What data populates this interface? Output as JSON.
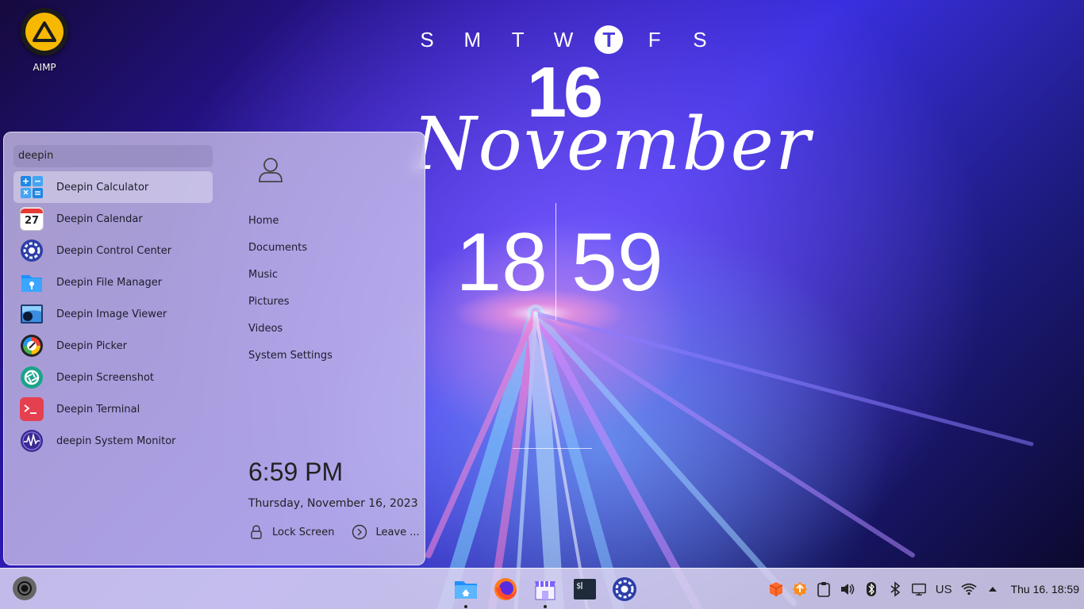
{
  "desktop": {
    "icons": [
      {
        "label": "AIMP"
      }
    ]
  },
  "clock_widget": {
    "weekdays": [
      "S",
      "M",
      "T",
      "W",
      "T",
      "F",
      "S"
    ],
    "active_weekday_index": 4,
    "day": "16",
    "month": "November",
    "hours": "18",
    "minutes": "59"
  },
  "launcher": {
    "search_value": "deepin",
    "apps": [
      {
        "label": "Deepin Calculator",
        "icon": "calculator-icon",
        "selected": true
      },
      {
        "label": "Deepin Calendar",
        "icon": "calendar-icon",
        "calendar_day": "27"
      },
      {
        "label": "Deepin Control Center",
        "icon": "control-center-icon"
      },
      {
        "label": "Deepin File Manager",
        "icon": "file-manager-icon"
      },
      {
        "label": "Deepin Image Viewer",
        "icon": "image-viewer-icon"
      },
      {
        "label": "Deepin Picker",
        "icon": "color-picker-icon"
      },
      {
        "label": "Deepin Screenshot",
        "icon": "screenshot-icon"
      },
      {
        "label": "Deepin Terminal",
        "icon": "terminal-icon"
      },
      {
        "label": "deepin System Monitor",
        "icon": "system-monitor-icon"
      }
    ],
    "places": [
      "Home",
      "Documents",
      "Music",
      "Pictures",
      "Videos",
      "System Settings"
    ],
    "time": "6:59 PM",
    "date": "Thursday, November 16, 2023",
    "lock_label": "Lock Screen",
    "leave_label": "Leave ..."
  },
  "taskbar": {
    "dock": [
      {
        "name": "file-manager-icon",
        "running": true
      },
      {
        "name": "firefox-icon",
        "running": false
      },
      {
        "name": "app-store-icon",
        "running": true
      },
      {
        "name": "terminal-icon",
        "running": false
      },
      {
        "name": "control-center-icon",
        "running": false
      }
    ],
    "keyboard_layout": "US",
    "clock": "Thu 16. 18:59"
  },
  "colors": {
    "accent": "#4a3bd8",
    "aimp_yellow": "#f6b800",
    "terminal_red": "#e5404f",
    "screenshot_teal": "#1aa48a"
  }
}
